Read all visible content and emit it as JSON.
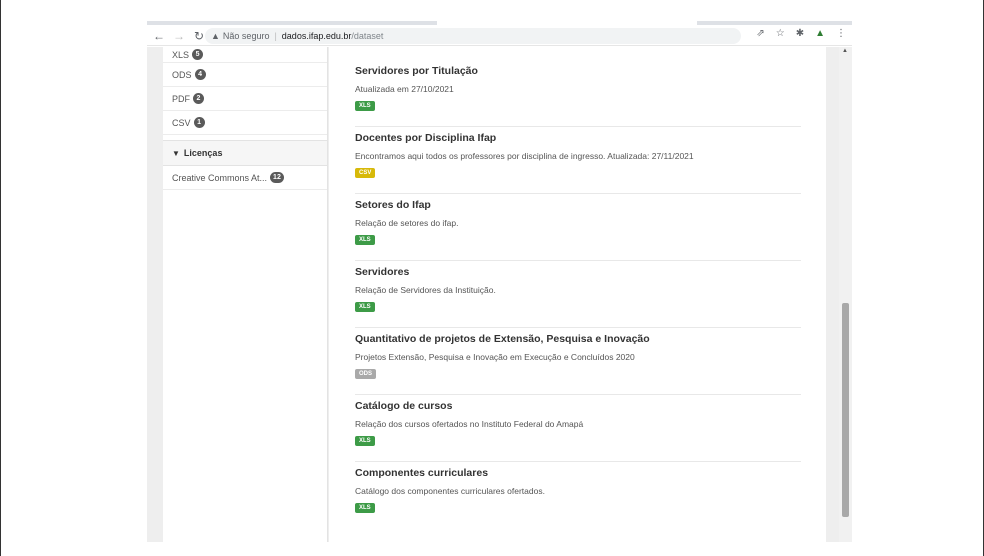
{
  "browser": {
    "security_label": "Não seguro",
    "url_host": "dados.ifap.edu.br",
    "url_path": "/dataset"
  },
  "sidebar": {
    "formats": [
      {
        "label": "XLS",
        "count": "5"
      },
      {
        "label": "ODS",
        "count": "4"
      },
      {
        "label": "PDF",
        "count": "2"
      },
      {
        "label": "CSV",
        "count": "1"
      }
    ],
    "licenses_heading": "Licenças",
    "licenses": [
      {
        "label": "Creative Commons At...",
        "count": "12"
      }
    ]
  },
  "datasets": [
    {
      "title": "Servidores por Titulação",
      "description": "Atualizada em 27/10/2021",
      "format": "XLS"
    },
    {
      "title": "Docentes por Disciplina Ifap",
      "description": "Encontramos aqui todos os professores por disciplina de ingresso. Atualizada: 27/11/2021",
      "format": "CSV"
    },
    {
      "title": "Setores do Ifap",
      "description": "Relação de setores do ifap.",
      "format": "XLS"
    },
    {
      "title": "Servidores",
      "description": "Relação de Servidores da Instituição.",
      "format": "XLS"
    },
    {
      "title": "Quantitativo de projetos de Extensão, Pesquisa e Inovação",
      "description": "Projetos Extensão, Pesquisa e Inovação em Execução e Concluídos 2020",
      "format": "ODS"
    },
    {
      "title": "Catálogo de cursos",
      "description": "Relação dos cursos ofertados no Instituto Federal do Amapá",
      "format": "XLS"
    },
    {
      "title": "Componentes curriculares",
      "description": "Catálogo dos componentes curriculares ofertados.",
      "format": "XLS"
    }
  ],
  "format_colors": {
    "XLS": "#3d9b47",
    "CSV": "#d7b90a",
    "ODS": "#a9a9a9"
  }
}
